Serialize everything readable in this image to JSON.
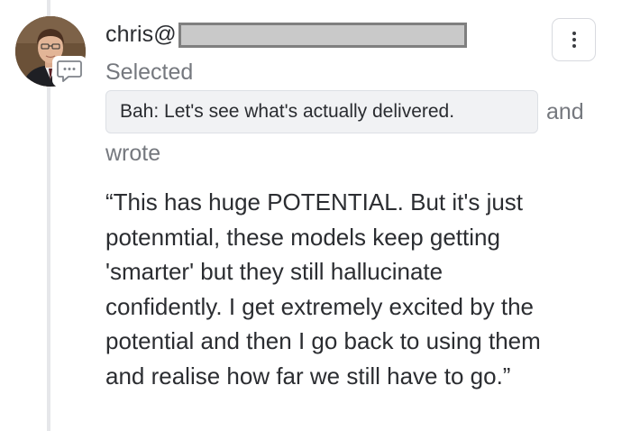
{
  "comment": {
    "author": "chris@",
    "action_label": "Selected",
    "selected_text": "Bah: Let's see what's actually delivered.",
    "conjunction": "and",
    "verb": "wrote",
    "body_lines": [
      "“This has huge POTENTIAL. But it's just",
      "potenmtial, these models keep getting",
      "'smarter' but they still hallucinate",
      "confidently. I get extremely excited by the",
      "potential and then I go back to using them",
      "and realise how far we still have to go.”"
    ]
  },
  "icons": {
    "avatar": "user-avatar-photo",
    "badge": "comment-bubble-icon",
    "menu": "vertical-ellipsis-icon"
  },
  "colors": {
    "text_primary": "#2b2d31",
    "text_secondary": "#75787e",
    "chip_background": "#f1f2f4",
    "thread_line": "#e6e7ea",
    "redaction_fill": "#c9c9c9"
  }
}
